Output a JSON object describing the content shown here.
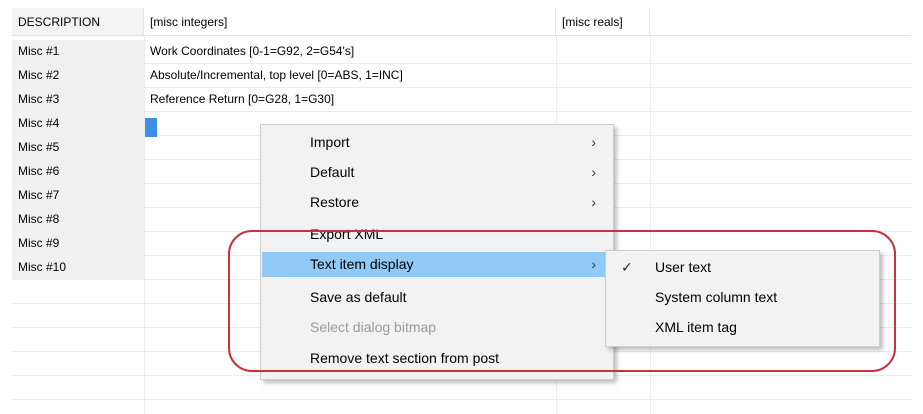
{
  "headers": {
    "description": "DESCRIPTION",
    "misc_integers": "[misc integers]",
    "misc_reals": "[misc reals]"
  },
  "rows": [
    {
      "label": "Misc #1",
      "value": "Work Coordinates [0-1=G92, 2=G54's]"
    },
    {
      "label": "Misc #2",
      "value": "Absolute/Incremental, top level [0=ABS, 1=INC]"
    },
    {
      "label": "Misc #3",
      "value": "Reference Return [0=G28, 1=G30]"
    },
    {
      "label": "Misc #4",
      "value": ""
    },
    {
      "label": "Misc #5",
      "value": ""
    },
    {
      "label": "Misc #6",
      "value": ""
    },
    {
      "label": "Misc #7",
      "value": ""
    },
    {
      "label": "Misc #8",
      "value": ""
    },
    {
      "label": "Misc #9",
      "value": ""
    },
    {
      "label": "Misc #10",
      "value": ""
    }
  ],
  "context_menu": {
    "items": [
      {
        "label": "Import",
        "submenu": true
      },
      {
        "label": "Default",
        "submenu": true
      },
      {
        "label": "Restore",
        "submenu": true
      },
      {
        "label": "Export XML",
        "submenu": false
      },
      {
        "label": "Text item display",
        "submenu": true,
        "highlighted": true
      },
      {
        "label": "Save as default",
        "submenu": false
      },
      {
        "label": "Select dialog bitmap",
        "submenu": false,
        "disabled": true
      },
      {
        "label": "Remove text section from post",
        "submenu": false
      }
    ],
    "arrow_glyph": "›"
  },
  "submenu": {
    "items": [
      {
        "label": "User text",
        "checked": true
      },
      {
        "label": "System column text",
        "checked": false
      },
      {
        "label": "XML item tag",
        "checked": false
      }
    ],
    "check_glyph": "✓"
  },
  "colors": {
    "highlight": "#91c9f7",
    "annotation": "#c8323c",
    "cursor": "#3b8fe8"
  }
}
